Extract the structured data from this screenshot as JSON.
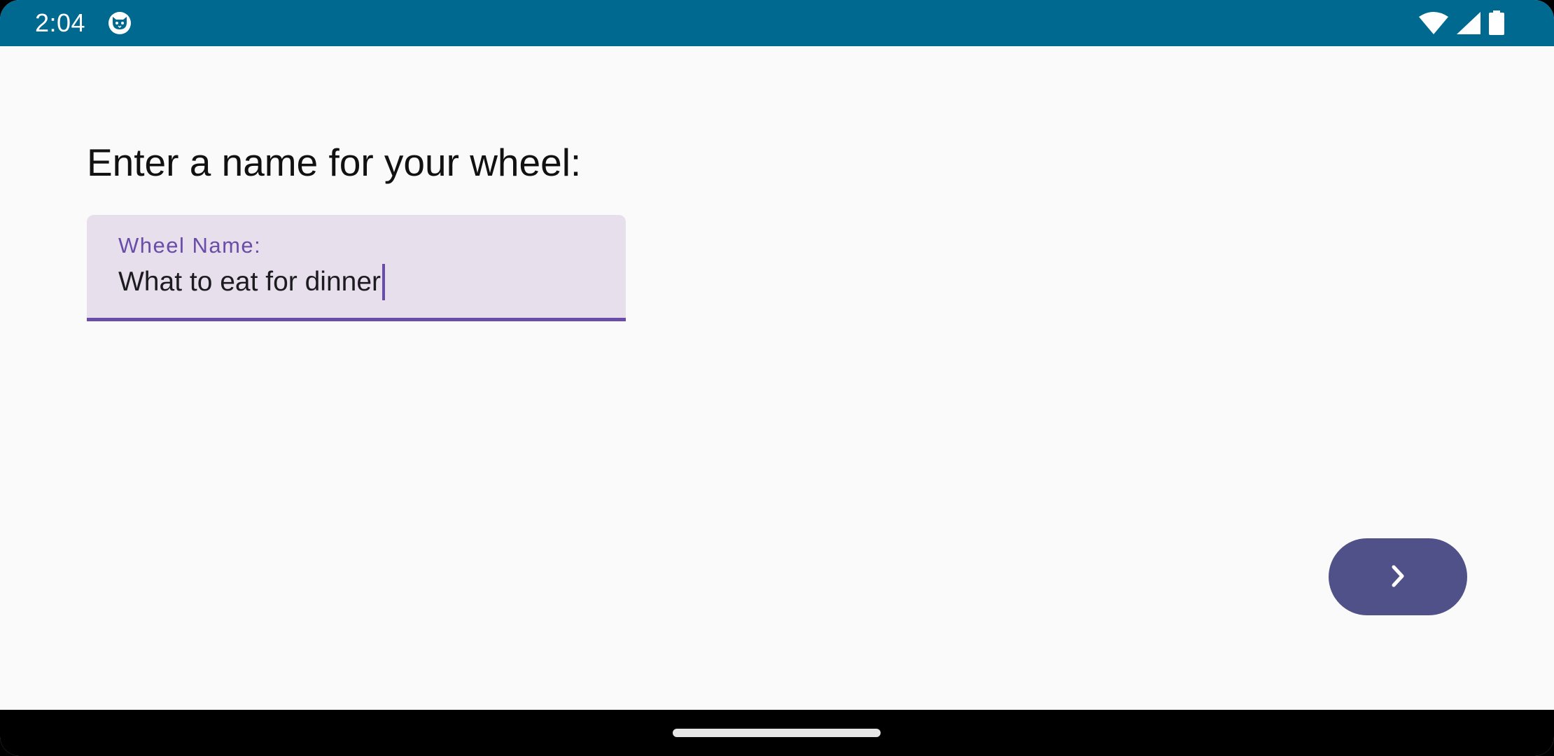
{
  "status_bar": {
    "time": "2:04",
    "app_icon": "cat-face-icon",
    "icons": [
      "wifi-icon",
      "cellular-signal-icon",
      "battery-icon"
    ],
    "background_color": "#00698f"
  },
  "form": {
    "heading": "Enter a name for your wheel:",
    "field": {
      "label": "Wheel Name:",
      "value": "What to eat for dinner",
      "background_color": "#e7dfec",
      "accent_color": "#6a4ca9"
    }
  },
  "next_button": {
    "icon": "chevron-right-icon",
    "background_color": "#515189"
  },
  "nav_bar": {
    "handle": "home-gesture-handle"
  }
}
